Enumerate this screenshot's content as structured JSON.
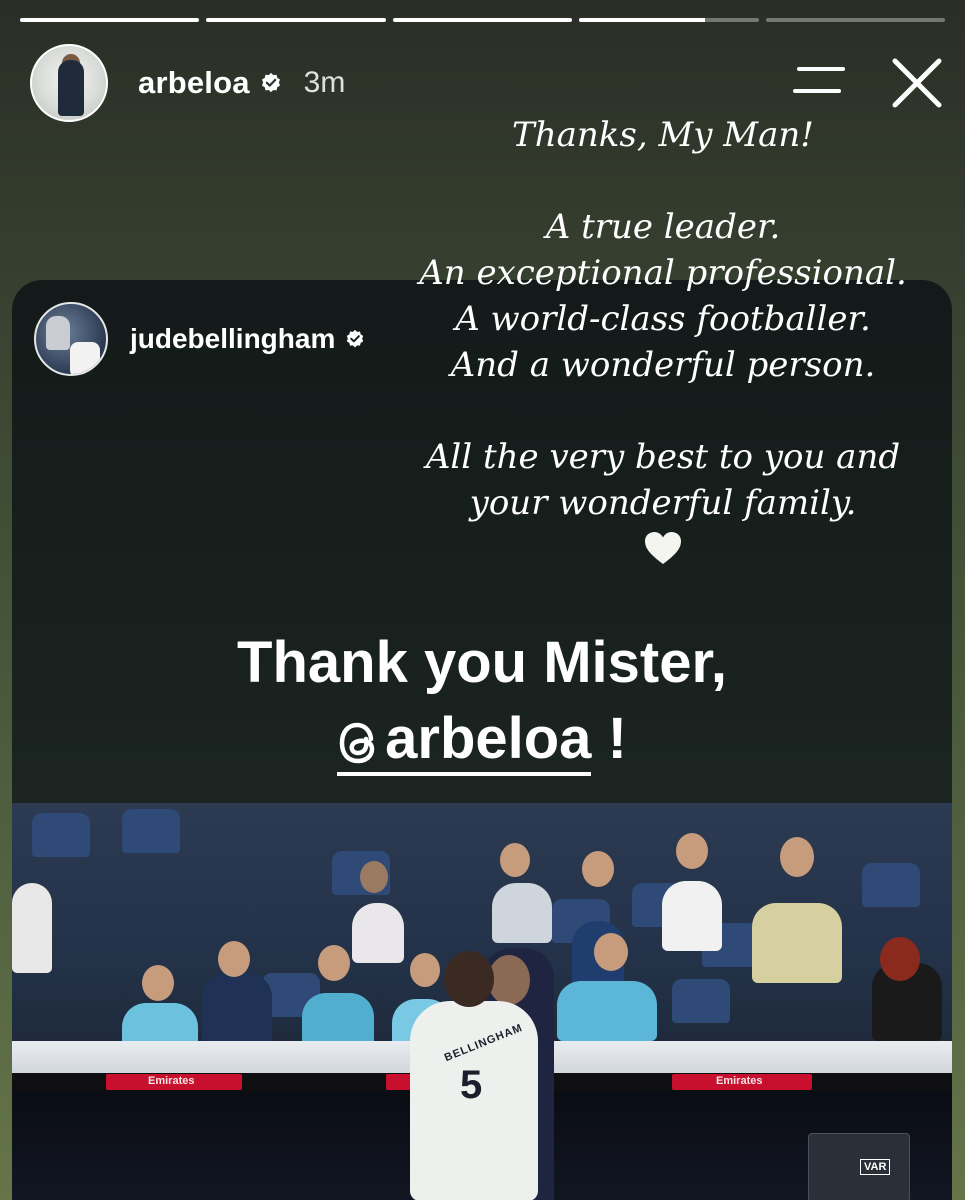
{
  "story": {
    "progress": [
      1,
      1,
      1,
      0.7,
      0
    ],
    "author": {
      "username": "arbeloa",
      "time": "3m"
    },
    "message": {
      "line1": "Thanks, My Man!",
      "line2": "A true leader.",
      "line3": "An exceptional professional.",
      "line4": "A world-class footballer.",
      "line5": "And a wonderful person.",
      "line6": "All the very best to you and",
      "line7": "your wonderful family.",
      "heart": "♡"
    }
  },
  "repost": {
    "username": "judebellingham",
    "headline_line1": "Thank you Mister,",
    "mention": "arbeloa",
    "exclaim": "!"
  },
  "photo": {
    "jersey_number": "5",
    "jersey_name": "BELLINGHAM",
    "ad_text": "Emirates",
    "var_label": "VAR"
  },
  "icons": {
    "menu": "menu-icon",
    "close": "close-icon",
    "verified": "verified-badge-icon",
    "threads": "threads-icon"
  }
}
